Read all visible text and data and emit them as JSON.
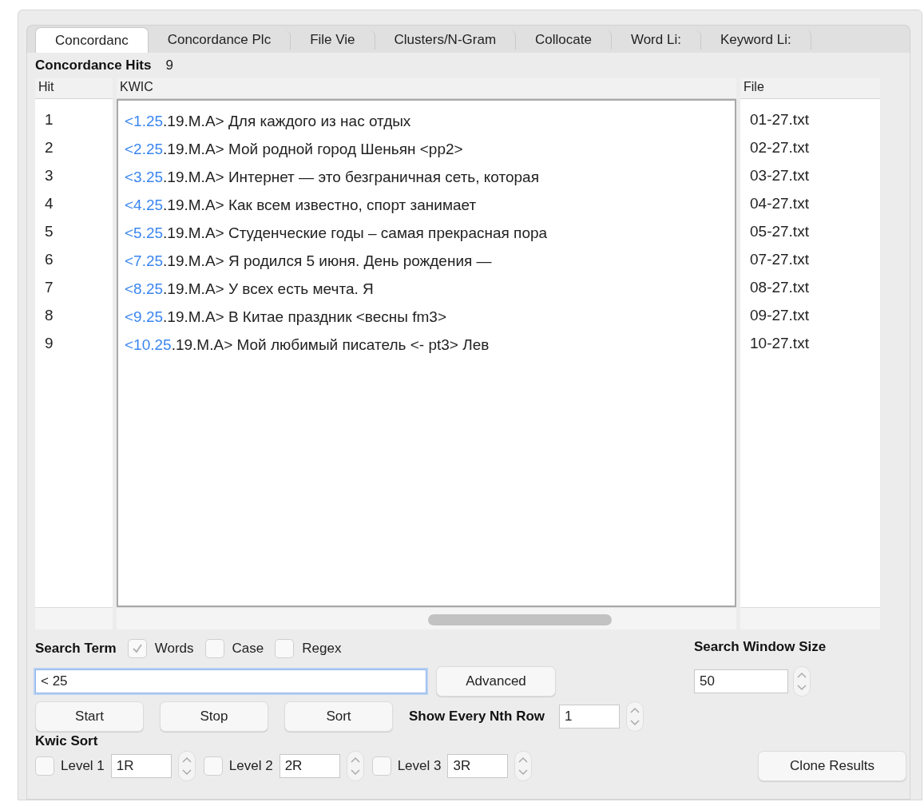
{
  "tabs": [
    {
      "label": "Concordanc",
      "selected": true
    },
    {
      "label": "Concordance Plc",
      "selected": false
    },
    {
      "label": "File Vie",
      "selected": false
    },
    {
      "label": "Clusters/N-Gram",
      "selected": false
    },
    {
      "label": "Collocate",
      "selected": false
    },
    {
      "label": "Word Li:",
      "selected": false
    },
    {
      "label": "Keyword Li:",
      "selected": false
    }
  ],
  "hits": {
    "label": "Concordance Hits",
    "count": "9"
  },
  "table": {
    "columns": [
      "Hit",
      "KWIC",
      "File"
    ],
    "rows": [
      {
        "hit": "1",
        "match": "<1.25",
        "rest": ".19.M.A> Для каждого из нас отдых",
        "file": "01-27.txt"
      },
      {
        "hit": "2",
        "match": "<2.25",
        "rest": ".19.M.A> Мой родной город Шеньян <pp2>",
        "file": "02-27.txt"
      },
      {
        "hit": "3",
        "match": "<3.25",
        "rest": ".19.M.A> Интернет — это безграничная сеть, которая",
        "file": "03-27.txt"
      },
      {
        "hit": "4",
        "match": "<4.25",
        "rest": ".19.M.A> Как всем известно, спорт занимает",
        "file": "04-27.txt"
      },
      {
        "hit": "5",
        "match": "<5.25",
        "rest": ".19.M.A> Студенческие годы – самая прекрасная пора",
        "file": "05-27.txt"
      },
      {
        "hit": "6",
        "match": "<7.25",
        "rest": ".19.M.A> Я родился 5 июня. День рождения —",
        "file": "07-27.txt"
      },
      {
        "hit": "7",
        "match": "<8.25",
        "rest": ".19.M.A> У всех есть мечта. Я",
        "file": "08-27.txt"
      },
      {
        "hit": "8",
        "match": "<9.25",
        "rest": ".19.M.A> В Китае праздник <весны fm3>",
        "file": "09-27.txt"
      },
      {
        "hit": "9",
        "match": "<10.25",
        "rest": ".19.M.A> Мой любимый писатель <- pt3> Лев",
        "file": "10-27.txt"
      }
    ]
  },
  "search": {
    "label": "Search Term",
    "options": [
      {
        "label": "Words",
        "checked": true
      },
      {
        "label": "Case",
        "checked": false
      },
      {
        "label": "Regex",
        "checked": false
      }
    ],
    "value": "< 25",
    "advanced": "Advanced",
    "window_label": "Search Window Size",
    "window_value": "50"
  },
  "buttons": [
    "Start",
    "Stop",
    "Sort"
  ],
  "nth_row": {
    "label": "Show Every Nth Row",
    "value": "1"
  },
  "kwic_sort": {
    "label": "Kwic Sort",
    "levels": [
      {
        "label": "Level 1",
        "value": "1R",
        "checked": false
      },
      {
        "label": "Level 2",
        "value": "2R",
        "checked": false
      },
      {
        "label": "Level 3",
        "value": "3R",
        "checked": false
      }
    ]
  },
  "clone": "Clone Results"
}
